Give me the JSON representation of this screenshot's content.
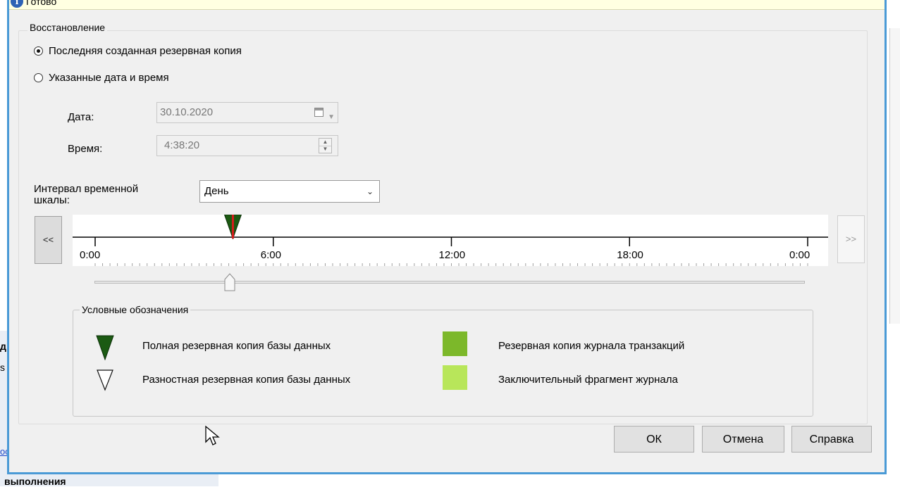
{
  "status": {
    "text": "Готово"
  },
  "restore_group": {
    "title": "Восстановление",
    "option_latest": "Последняя созданная резервная копия",
    "option_specific": "Указанные дата и время",
    "selected": "latest",
    "date_label": "Дата:",
    "date_value": "30.10.2020",
    "time_label": "Время:",
    "time_value": "4:38:20"
  },
  "timeline": {
    "interval_label_line1": "Интервал временной",
    "interval_label_line2": "шкалы:",
    "interval_value": "День",
    "prev_label": "<<",
    "next_label": ">>",
    "ticks": [
      "0:00",
      "6:00",
      "12:00",
      "18:00",
      "0:00"
    ],
    "marker_time_hours": 4.64,
    "slider_position": 0.19
  },
  "legend": {
    "title": "Условные обозначения",
    "full_backup": "Полная резервная копия базы данных",
    "diff_backup": "Разностная резервная копия базы данных",
    "log_backup": "Резервная копия журнала транзакций",
    "tail_log": "Заключительный фрагмент журнала",
    "colors": {
      "full": "#1b5a12",
      "log": "#7cb82a",
      "tail": "#b8e65a"
    }
  },
  "buttons": {
    "ok": "ОК",
    "cancel": "Отмена",
    "help": "Справка"
  },
  "background": {
    "item1": "д",
    "item2": "s",
    "item3": "ос",
    "item4": "выполнения"
  },
  "colors": {
    "dialog_border": "#4a9ad6",
    "status_bar": "#ffffe1"
  }
}
